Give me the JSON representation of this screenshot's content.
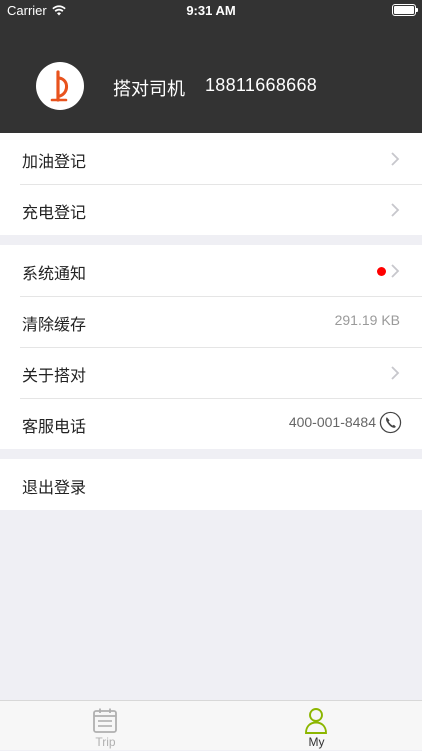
{
  "status_bar": {
    "carrier": "Carrier",
    "time": "9:31 AM"
  },
  "profile": {
    "name": "搭对司机",
    "phone": "18811668668"
  },
  "groups": [
    {
      "items": [
        {
          "label": "加油登记"
        },
        {
          "label": "充电登记"
        }
      ]
    },
    {
      "items": [
        {
          "label": "系统通知"
        },
        {
          "label": "清除缓存",
          "value": "291.19 KB"
        },
        {
          "label": "关于搭对"
        },
        {
          "label": "客服电话",
          "value": "400-001-8484"
        }
      ]
    },
    {
      "items": [
        {
          "label": "退出登录"
        }
      ]
    }
  ],
  "tabbar": {
    "tabs": [
      {
        "label": "Trip",
        "icon": "calendar-icon",
        "active": false
      },
      {
        "label": "My",
        "icon": "person-icon",
        "active": true
      }
    ],
    "active_color": "#8cb600",
    "inactive_color": "#b0b0b0"
  },
  "colors": {
    "header_bg": "#333333",
    "logo_accent": "#e8531e",
    "notification_dot": "#ff0000"
  }
}
